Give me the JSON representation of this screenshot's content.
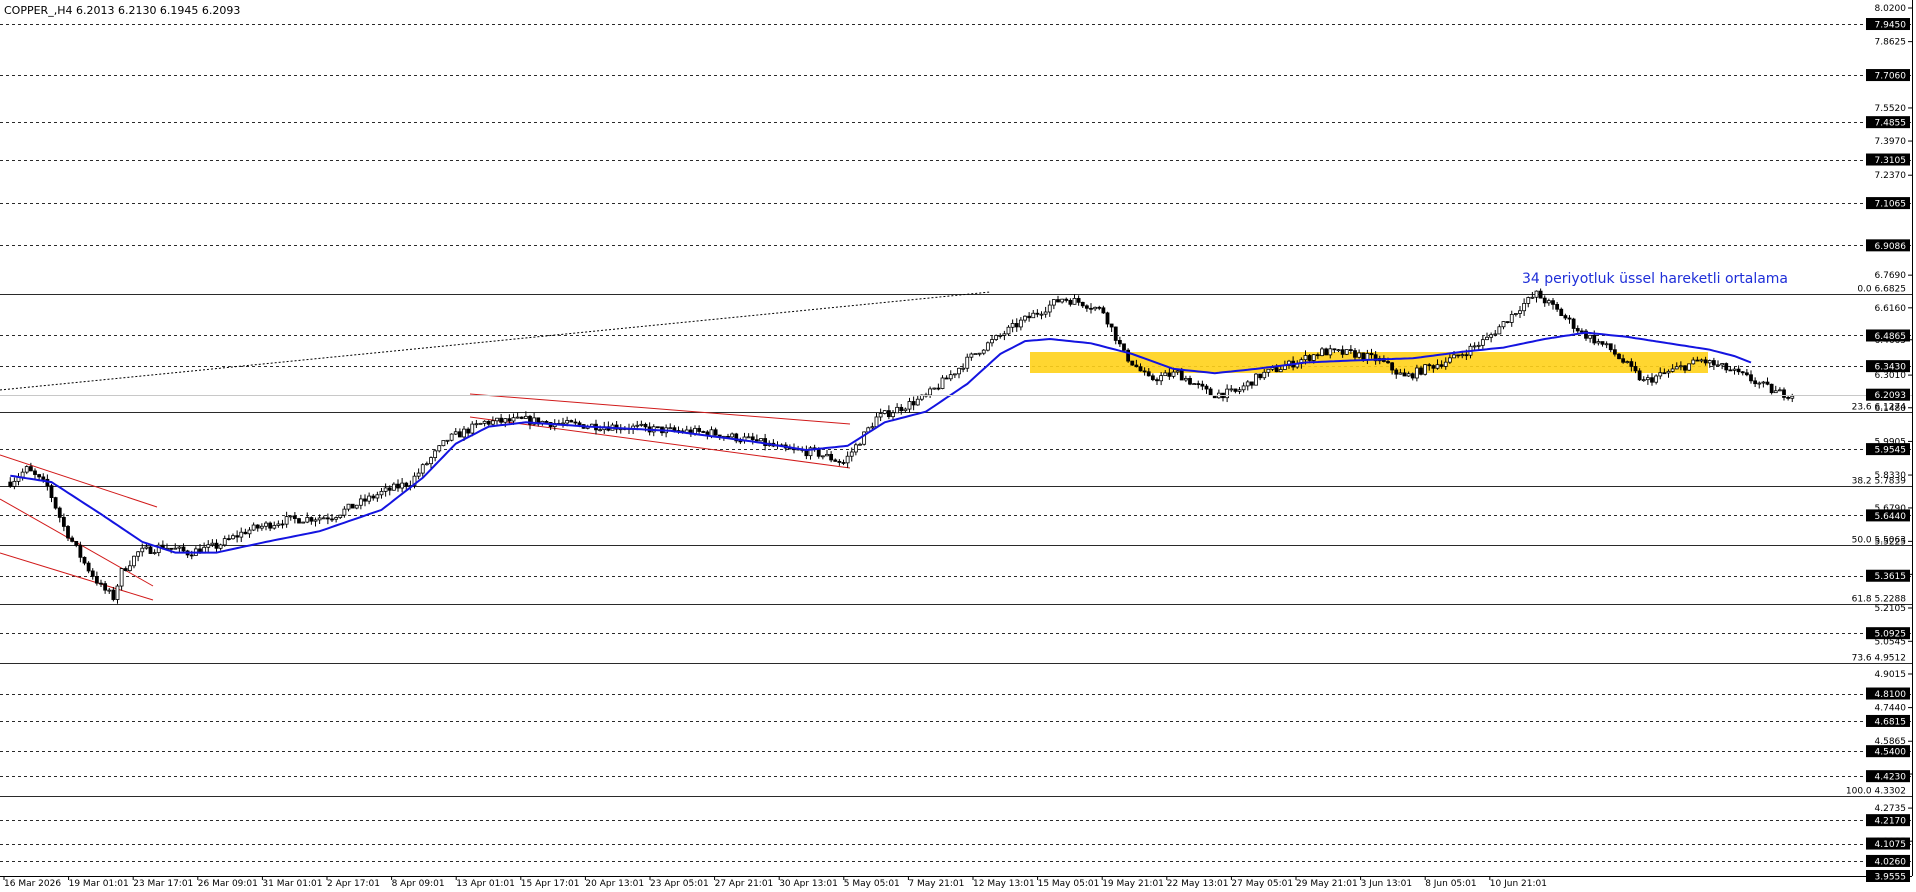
{
  "chart_data": {
    "type": "candlestick",
    "header": "COPPER_,H4  6.2013 6.2130 6.1945 6.2093",
    "annotation": "34 periyotluk üssel hareketli ortalama",
    "y_range": [
      3.9555,
      8.02
    ],
    "current_price": "6.2093",
    "price_scale_ticks": [
      "8.0200",
      "7.8625",
      "7.5520",
      "7.3970",
      "7.2370",
      "6.7690",
      "6.6160",
      "6.4665",
      "6.3010",
      "6.1480",
      "5.9905",
      "5.8330",
      "5.6790",
      "5.5225",
      "5.3680",
      "5.2105",
      "5.0545",
      "4.9015",
      "4.7440",
      "4.5865",
      "4.4330",
      "4.2735",
      "4.1185"
    ],
    "horizontal_levels": [
      "7.9450",
      "7.7060",
      "7.4855",
      "7.3105",
      "7.1065",
      "6.9086",
      "6.4865",
      "6.3430",
      "5.9545",
      "5.6440",
      "5.3615",
      "5.0925",
      "4.8100",
      "4.6815",
      "4.5400",
      "4.4230",
      "4.2170",
      "4.1075",
      "4.0260",
      "3.9555"
    ],
    "fibonacci_levels": [
      {
        "label": "0.0 6.6825",
        "value": 6.6825
      },
      {
        "label": "23.6 6.1274",
        "value": 6.1274
      },
      {
        "label": "38.2 5.7839",
        "value": 5.7839
      },
      {
        "label": "50.0 5.5063",
        "value": 5.5063
      },
      {
        "label": "61.8 5.2288",
        "value": 5.2288
      },
      {
        "label": "73.6 4.9512",
        "value": 4.9512
      },
      {
        "label": "100.0 4.3302",
        "value": 4.3302
      }
    ],
    "x_labels": [
      "16 Mar 2026",
      "19 Mar 01:01",
      "23 Mar 17:01",
      "26 Mar 09:01",
      "31 Mar 01:01",
      "2 Apr 17:01",
      "8 Apr 09:01",
      "13 Apr 01:01",
      "15 Apr 17:01",
      "20 Apr 13:01",
      "23 Apr 05:01",
      "27 Apr 21:01",
      "30 Apr 13:01",
      "5 May 05:01",
      "7 May 21:01",
      "12 May 13:01",
      "15 May 05:01",
      "19 May 21:01",
      "22 May 13:01",
      "27 May 05:01",
      "29 May 21:01",
      "3 Jun 13:01",
      "8 Jun 05:01",
      "10 Jun 21:01"
    ],
    "price_path": [
      [
        0,
        5.8
      ],
      [
        4,
        5.86
      ],
      [
        9,
        5.78
      ],
      [
        13,
        5.59
      ],
      [
        18,
        5.42
      ],
      [
        22,
        5.31
      ],
      [
        25,
        5.26
      ],
      [
        27,
        5.38
      ],
      [
        31,
        5.47
      ],
      [
        37,
        5.5
      ],
      [
        43,
        5.47
      ],
      [
        50,
        5.5
      ],
      [
        57,
        5.57
      ],
      [
        66,
        5.62
      ],
      [
        78,
        5.64
      ],
      [
        90,
        5.75
      ],
      [
        97,
        5.8
      ],
      [
        106,
        6.0
      ],
      [
        115,
        6.08
      ],
      [
        125,
        6.09
      ],
      [
        135,
        6.07
      ],
      [
        148,
        6.06
      ],
      [
        160,
        6.04
      ],
      [
        170,
        6.03
      ],
      [
        181,
        5.99
      ],
      [
        188,
        5.95
      ],
      [
        195,
        5.94
      ],
      [
        202,
        5.89
      ],
      [
        210,
        6.1
      ],
      [
        222,
        6.2
      ],
      [
        235,
        6.42
      ],
      [
        245,
        6.55
      ],
      [
        255,
        6.66
      ],
      [
        260,
        6.64
      ],
      [
        265,
        6.6
      ],
      [
        270,
        6.4
      ],
      [
        276,
        6.28
      ],
      [
        283,
        6.31
      ],
      [
        291,
        6.21
      ],
      [
        297,
        6.22
      ],
      [
        303,
        6.3
      ],
      [
        310,
        6.35
      ],
      [
        318,
        6.41
      ],
      [
        326,
        6.4
      ],
      [
        332,
        6.37
      ],
      [
        338,
        6.29
      ],
      [
        344,
        6.34
      ],
      [
        350,
        6.38
      ],
      [
        358,
        6.47
      ],
      [
        366,
        6.62
      ],
      [
        370,
        6.68
      ],
      [
        374,
        6.62
      ],
      [
        381,
        6.5
      ],
      [
        388,
        6.42
      ],
      [
        396,
        6.27
      ],
      [
        404,
        6.33
      ],
      [
        410,
        6.37
      ],
      [
        416,
        6.33
      ],
      [
        422,
        6.28
      ],
      [
        428,
        6.22
      ],
      [
        432,
        6.21
      ]
    ],
    "ema_path": [
      [
        0,
        5.83
      ],
      [
        10,
        5.8
      ],
      [
        22,
        5.65
      ],
      [
        32,
        5.52
      ],
      [
        40,
        5.47
      ],
      [
        50,
        5.47
      ],
      [
        62,
        5.52
      ],
      [
        75,
        5.57
      ],
      [
        90,
        5.67
      ],
      [
        100,
        5.82
      ],
      [
        108,
        5.98
      ],
      [
        116,
        6.06
      ],
      [
        125,
        6.08
      ],
      [
        140,
        6.06
      ],
      [
        160,
        6.04
      ],
      [
        180,
        5.99
      ],
      [
        193,
        5.95
      ],
      [
        203,
        5.97
      ],
      [
        212,
        6.08
      ],
      [
        222,
        6.13
      ],
      [
        232,
        6.26
      ],
      [
        240,
        6.4
      ],
      [
        246,
        6.46
      ],
      [
        252,
        6.47
      ],
      [
        262,
        6.45
      ],
      [
        272,
        6.4
      ],
      [
        282,
        6.33
      ],
      [
        292,
        6.31
      ],
      [
        302,
        6.33
      ],
      [
        314,
        6.36
      ],
      [
        326,
        6.37
      ],
      [
        340,
        6.38
      ],
      [
        352,
        6.41
      ],
      [
        362,
        6.43
      ],
      [
        372,
        6.47
      ],
      [
        382,
        6.5
      ],
      [
        392,
        6.48
      ],
      [
        402,
        6.45
      ],
      [
        412,
        6.42
      ],
      [
        418,
        6.39
      ],
      [
        422,
        6.36
      ]
    ],
    "n_bars": 432,
    "bar_offset": 2
  }
}
